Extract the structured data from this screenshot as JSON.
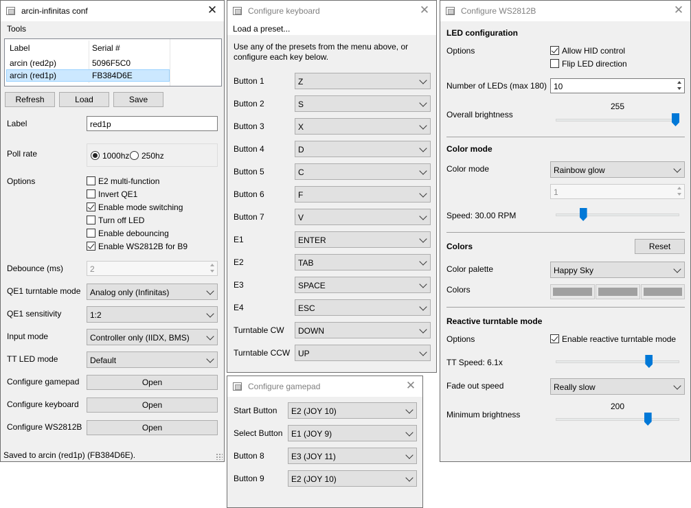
{
  "main": {
    "title": "arcin-infinitas conf",
    "menu": [
      "Tools"
    ],
    "table": {
      "headers": [
        "Label",
        "Serial #"
      ],
      "rows": [
        [
          "arcin (red2p)",
          "5096F5C0"
        ],
        [
          "arcin (red1p)",
          "FB384D6E"
        ]
      ]
    },
    "buttons": {
      "refresh": "Refresh",
      "load": "Load",
      "save": "Save"
    },
    "label_caption": "Label",
    "label_value": "red1p",
    "poll_rate": {
      "caption": "Poll rate",
      "options": [
        "1000hz",
        "250hz"
      ],
      "selected": "1000hz"
    },
    "options_caption": "Options",
    "options": [
      {
        "label": "E2 multi-function",
        "checked": false
      },
      {
        "label": "Invert QE1",
        "checked": false
      },
      {
        "label": "Enable mode switching",
        "checked": true
      },
      {
        "label": "Turn off LED",
        "checked": false
      },
      {
        "label": "Enable debouncing",
        "checked": false
      },
      {
        "label": "Enable WS2812B for B9",
        "checked": true
      }
    ],
    "debounce": {
      "caption": "Debounce (ms)",
      "value": "2"
    },
    "combos": [
      {
        "caption": "QE1 turntable mode",
        "value": "Analog only (Infinitas)"
      },
      {
        "caption": "QE1 sensitivity",
        "value": "1:2"
      },
      {
        "caption": "Input mode",
        "value": "Controller only (IIDX, BMS)"
      },
      {
        "caption": "TT LED mode",
        "value": "Default"
      }
    ],
    "configure": [
      {
        "caption": "Configure gamepad",
        "button": "Open"
      },
      {
        "caption": "Configure keyboard",
        "button": "Open"
      },
      {
        "caption": "Configure WS2812B",
        "button": "Open"
      }
    ],
    "status": "Saved to arcin (red1p) (FB384D6E)."
  },
  "keyboard": {
    "title": "Configure keyboard",
    "menu": "Load a preset...",
    "description_line1": "Use any of the presets from the menu above, or",
    "description_line2": "configure each key below.",
    "keys": [
      {
        "label": "Button 1",
        "value": "Z"
      },
      {
        "label": "Button 2",
        "value": "S"
      },
      {
        "label": "Button 3",
        "value": "X"
      },
      {
        "label": "Button 4",
        "value": "D"
      },
      {
        "label": "Button 5",
        "value": "C"
      },
      {
        "label": "Button 6",
        "value": "F"
      },
      {
        "label": "Button 7",
        "value": "V"
      },
      {
        "label": "E1",
        "value": "ENTER"
      },
      {
        "label": "E2",
        "value": "TAB"
      },
      {
        "label": "E3",
        "value": "SPACE"
      },
      {
        "label": "E4",
        "value": "ESC"
      },
      {
        "label": "Turntable CW",
        "value": "DOWN"
      },
      {
        "label": "Turntable CCW",
        "value": "UP"
      }
    ]
  },
  "gamepad": {
    "title": "Configure gamepad",
    "mappings": [
      {
        "label": "Start Button",
        "value": "E2 (JOY 10)"
      },
      {
        "label": "Select Button",
        "value": "E1 (JOY 9)"
      },
      {
        "label": "Button 8",
        "value": "E3 (JOY 11)"
      },
      {
        "label": "Button 9",
        "value": "E2 (JOY 10)"
      }
    ]
  },
  "ws": {
    "title": "Configure WS2812B",
    "led_config": {
      "heading": "LED configuration",
      "options_caption": "Options",
      "allow_hid": {
        "label": "Allow HID control",
        "checked": true
      },
      "flip": {
        "label": "Flip LED direction",
        "checked": false
      },
      "num_leds_caption": "Number of LEDs (max 180)",
      "num_leds": "10",
      "brightness_caption": "Overall brightness",
      "brightness_value": "255",
      "brightness_level": 1.0
    },
    "color_mode": {
      "heading": "Color mode",
      "caption": "Color mode",
      "value": "Rainbow glow",
      "spin_value": "1",
      "speed_caption": "Speed: 30.00 RPM",
      "speed_level": 0.2
    },
    "colors": {
      "heading": "Colors",
      "reset": "Reset",
      "palette_caption": "Color palette",
      "palette_value": "Happy Sky",
      "colors_caption": "Colors",
      "swatch_color": "#a0a0a0"
    },
    "reactive": {
      "heading": "Reactive turntable mode",
      "options_caption": "Options",
      "enable": {
        "label": "Enable reactive turntable mode",
        "checked": true
      },
      "tt_speed_caption": "TT Speed: 6.1x",
      "tt_speed_level": 0.77,
      "fade_caption": "Fade out speed",
      "fade_value": "Really slow",
      "min_brightness_caption": "Minimum brightness",
      "min_brightness_value": "200",
      "min_brightness_level": 0.76
    }
  },
  "colors": {
    "accent": "#0078d7",
    "selection": "#cce8ff",
    "selection_border": "#99d1ff"
  }
}
